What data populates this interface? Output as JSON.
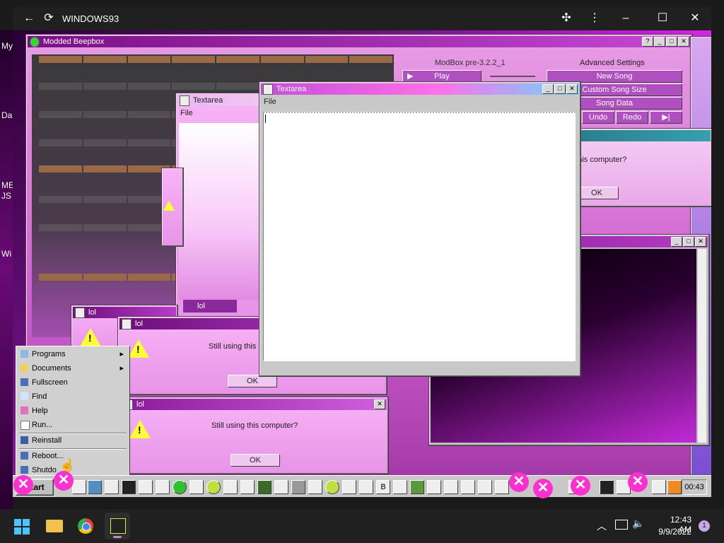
{
  "browser": {
    "title": "WINDOWS93"
  },
  "desktop_icons": [
    {
      "label": "My"
    },
    {
      "label": "Da"
    },
    {
      "label": "ME"
    },
    {
      "label": "JS"
    },
    {
      "label": "Wi"
    }
  ],
  "beepbox": {
    "title": "Modded Beepbox",
    "version": "ModBox pre-3.2.2_1",
    "advanced_label": "Advanced Settings",
    "play_label": "Play",
    "new_song": "New Song",
    "custom_size": "Custom Song Size",
    "song_data": "Song Data",
    "undo": "Undo",
    "redo": "Redo",
    "skip": "▶|"
  },
  "textarea_main": {
    "title": "Textarea",
    "menu_file": "File",
    "value": ""
  },
  "textarea_back": {
    "title": "Textarea",
    "menu_file": "File",
    "tab_label": "lol"
  },
  "dialog_right": {
    "message": "g this computer?",
    "ok": "OK"
  },
  "dialog_lol1": {
    "title": "lol"
  },
  "dialog_lol2": {
    "title": "lol",
    "message": "Still using this",
    "ok": "OK"
  },
  "dialog_lol3": {
    "title": "lol",
    "message": "Still using this computer?",
    "ok": "OK"
  },
  "start_menu": {
    "items": [
      {
        "label": "Programs",
        "icon": "programs-icon",
        "arrow": "▸"
      },
      {
        "label": "Documents",
        "icon": "folder-icon",
        "arrow": "▸"
      },
      {
        "label": "Fullscreen",
        "icon": "fullscreen-icon"
      },
      {
        "label": "Find",
        "icon": "find-icon"
      },
      {
        "label": "Help",
        "icon": "help-icon"
      },
      {
        "label": "Run...",
        "icon": "run-icon"
      },
      {
        "label": "Reinstall",
        "icon": "reinstall-icon"
      },
      {
        "label": "Reboot...",
        "icon": "reboot-icon"
      },
      {
        "label": "Shutdo",
        "icon": "shutdown-icon"
      }
    ]
  },
  "taskbar": {
    "start_label": "Start",
    "clock": "00:43",
    "b_label": "B"
  },
  "win11": {
    "time": "12:43 AM",
    "date": "9/9/2022",
    "notifications": "1"
  }
}
